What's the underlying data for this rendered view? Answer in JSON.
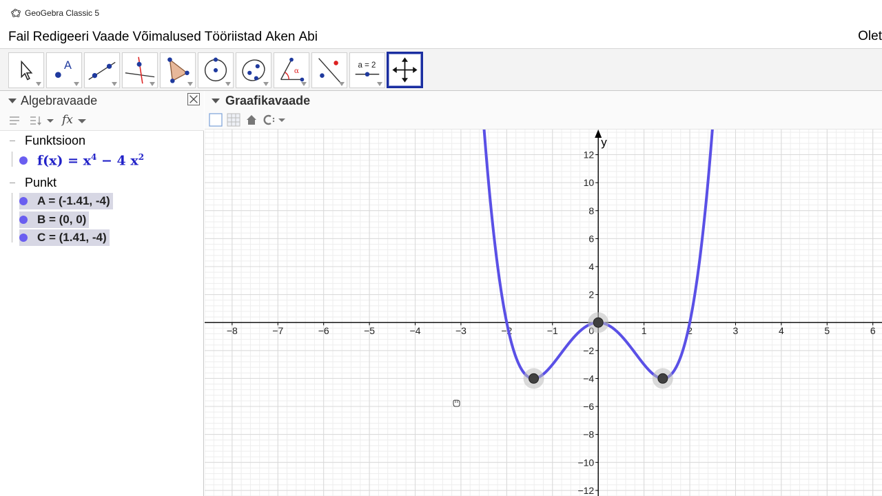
{
  "window": {
    "title": "GeoGebra Classic 5"
  },
  "menu": {
    "items": [
      "Fail",
      "Redigeeri",
      "Vaade",
      "Võimalused",
      "Tööriistad",
      "Aken",
      "Abi"
    ],
    "right_text": "Olet"
  },
  "toolbar": {
    "tools": [
      {
        "name": "move-tool-icon"
      },
      {
        "name": "point-tool-icon",
        "label": "A"
      },
      {
        "name": "line-tool-icon"
      },
      {
        "name": "perpendicular-line-tool-icon"
      },
      {
        "name": "polygon-tool-icon"
      },
      {
        "name": "circle-tool-icon"
      },
      {
        "name": "ellipse-tool-icon"
      },
      {
        "name": "angle-tool-icon",
        "label": "α"
      },
      {
        "name": "reflect-tool-icon"
      },
      {
        "name": "slider-tool-icon",
        "label": "a = 2"
      },
      {
        "name": "move-graphics-view-tool-icon",
        "selected": true
      }
    ]
  },
  "algebra": {
    "title": "Algebravaade",
    "categories": [
      {
        "label": "Funktsioon"
      },
      {
        "label": "Punkt"
      }
    ],
    "function": {
      "lhs": "f(x)",
      "eq": "=",
      "t1": "x",
      "e1": "4",
      "minus": "−",
      "coef": "4",
      "t2": "x",
      "e2": "2"
    },
    "points": [
      {
        "label": "A = (-1.41, -4)"
      },
      {
        "label": "B = (0, 0)"
      },
      {
        "label": "C = (1.41, -4)"
      }
    ],
    "fx_label": "fx"
  },
  "graphics": {
    "title": "Graafikavaade",
    "y_axis_label": "y",
    "colors": {
      "curve": "#5a50e6",
      "point": "#404040",
      "grid_major": "#d9d9d9",
      "grid_minor": "#eeeeee",
      "axis": "#000000"
    }
  },
  "chart_data": {
    "type": "line",
    "function": "x^4 - 4x^2",
    "x_range": [
      -8.6,
      6.2
    ],
    "y_range": [
      -12.4,
      13.8
    ],
    "x_ticks": [
      -8,
      -7,
      -6,
      -5,
      -4,
      -3,
      -2,
      -1,
      1,
      2,
      3,
      4,
      5,
      6
    ],
    "y_ticks": [
      -12,
      -10,
      -8,
      -6,
      -4,
      -2,
      2,
      4,
      6,
      8,
      10,
      12
    ],
    "origin_label": "0",
    "grid": true,
    "points": [
      {
        "name": "A",
        "x": -1.41,
        "y": -4
      },
      {
        "name": "B",
        "x": 0,
        "y": 0
      },
      {
        "name": "C",
        "x": 1.41,
        "y": -4
      }
    ]
  }
}
